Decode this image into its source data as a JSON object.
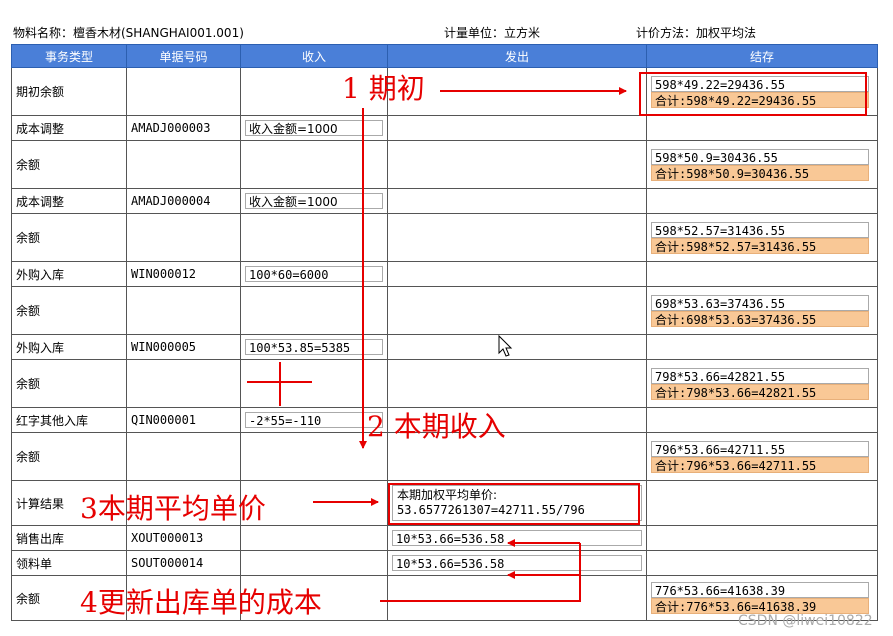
{
  "header": {
    "material": "物料名称：檀香木材(SHANGHAI001.001)",
    "unit": "计量单位：立方米",
    "method": "计价方法：加权平均法"
  },
  "columns": [
    "事务类型",
    "单据号码",
    "收入",
    "发出",
    "结存"
  ],
  "rows": [
    {
      "type": "期初余额",
      "doc": "",
      "income": "",
      "issue": "",
      "bal1": "598*49.22=29436.55",
      "bal2": "合计:598*49.22=29436.55"
    },
    {
      "type": "成本调整",
      "doc": "AMADJ000003",
      "income": "收入金额=1000",
      "issue": "",
      "bal1": "",
      "bal2": ""
    },
    {
      "type": "余额",
      "doc": "",
      "income": "",
      "issue": "",
      "bal1": "598*50.9=30436.55",
      "bal2": "合计:598*50.9=30436.55"
    },
    {
      "type": "成本调整",
      "doc": "AMADJ000004",
      "income": "收入金额=1000",
      "issue": "",
      "bal1": "",
      "bal2": ""
    },
    {
      "type": "余额",
      "doc": "",
      "income": "",
      "issue": "",
      "bal1": "598*52.57=31436.55",
      "bal2": "合计:598*52.57=31436.55"
    },
    {
      "type": "外购入库",
      "doc": "WIN000012",
      "income": "100*60=6000",
      "issue": "",
      "bal1": "",
      "bal2": ""
    },
    {
      "type": "余额",
      "doc": "",
      "income": "",
      "issue": "",
      "bal1": "698*53.63=37436.55",
      "bal2": "合计:698*53.63=37436.55"
    },
    {
      "type": "外购入库",
      "doc": "WIN000005",
      "income": "100*53.85=5385",
      "issue": "",
      "bal1": "",
      "bal2": ""
    },
    {
      "type": "余额",
      "doc": "",
      "income": "",
      "issue": "",
      "bal1": "798*53.66=42821.55",
      "bal2": "合计:798*53.66=42821.55"
    },
    {
      "type": "红字其他入库",
      "doc": "QIN000001",
      "income": "-2*55=-110",
      "issue": "",
      "bal1": "",
      "bal2": ""
    },
    {
      "type": "余额",
      "doc": "",
      "income": "",
      "issue": "",
      "bal1": "796*53.66=42711.55",
      "bal2": "合计:796*53.66=42711.55"
    },
    {
      "type": "计算结果",
      "doc": "",
      "income": "",
      "issue1": "本期加权平均单价:",
      "issue2": "53.6577261307=42711.55/796",
      "bal1": "",
      "bal2": ""
    },
    {
      "type": "销售出库",
      "doc": "XOUT000013",
      "income": "",
      "issue": "10*53.66=536.58",
      "bal1": "",
      "bal2": ""
    },
    {
      "type": "领料单",
      "doc": "SOUT000014",
      "income": "",
      "issue": "10*53.66=536.58",
      "bal1": "",
      "bal2": ""
    },
    {
      "type": "余额",
      "doc": "",
      "income": "",
      "issue": "",
      "bal1": "776*53.66=41638.39",
      "bal2": "合计:776*53.66=41638.39"
    }
  ],
  "annotations": {
    "a1": "1  期初",
    "a2": "2  本期收入",
    "a3": "3本期平均单价",
    "a4": "4更新出库单的成本"
  },
  "watermark": "CSDN @liwei10822",
  "colors": {
    "header": "#4a7fd8",
    "total_field": "#f9c896",
    "annotation": "#e60000"
  },
  "icons": {
    "cursor": "mouse-pointer-icon"
  }
}
